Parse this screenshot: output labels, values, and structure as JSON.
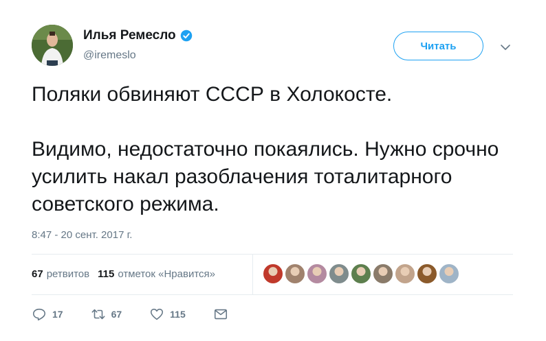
{
  "user": {
    "display_name": "Илья Ремесло",
    "handle": "@iremeslo"
  },
  "follow_button": {
    "label": "Читать"
  },
  "tweet": {
    "paragraphs": [
      "Поляки обвиняют СССР в Холокосте.",
      "Видимо, недостаточно покаялись. Нужно срочно усилить накал разоблачения тоталитарного советского режима."
    ],
    "timestamp": "8:47 - 20 сент. 2017 г."
  },
  "stats": {
    "retweets_count": "67",
    "retweets_label": "ретвитов",
    "likes_count": "115",
    "likes_label": "отметок «Нравится»"
  },
  "likers": [
    {
      "color": "#c0392b"
    },
    {
      "color": "#a0826d"
    },
    {
      "color": "#b48aa0"
    },
    {
      "color": "#7f8c8d"
    },
    {
      "color": "#5d7f4e"
    },
    {
      "color": "#8a7b6a"
    },
    {
      "color": "#c2a48c"
    },
    {
      "color": "#8b5a2b"
    },
    {
      "color": "#9fb4c7"
    }
  ],
  "actions": {
    "reply_count": "17",
    "retweet_count": "67",
    "like_count": "115"
  },
  "colors": {
    "accent": "#1da1f2",
    "muted": "#657786",
    "text": "#14171a",
    "border": "#e6ecf0"
  }
}
